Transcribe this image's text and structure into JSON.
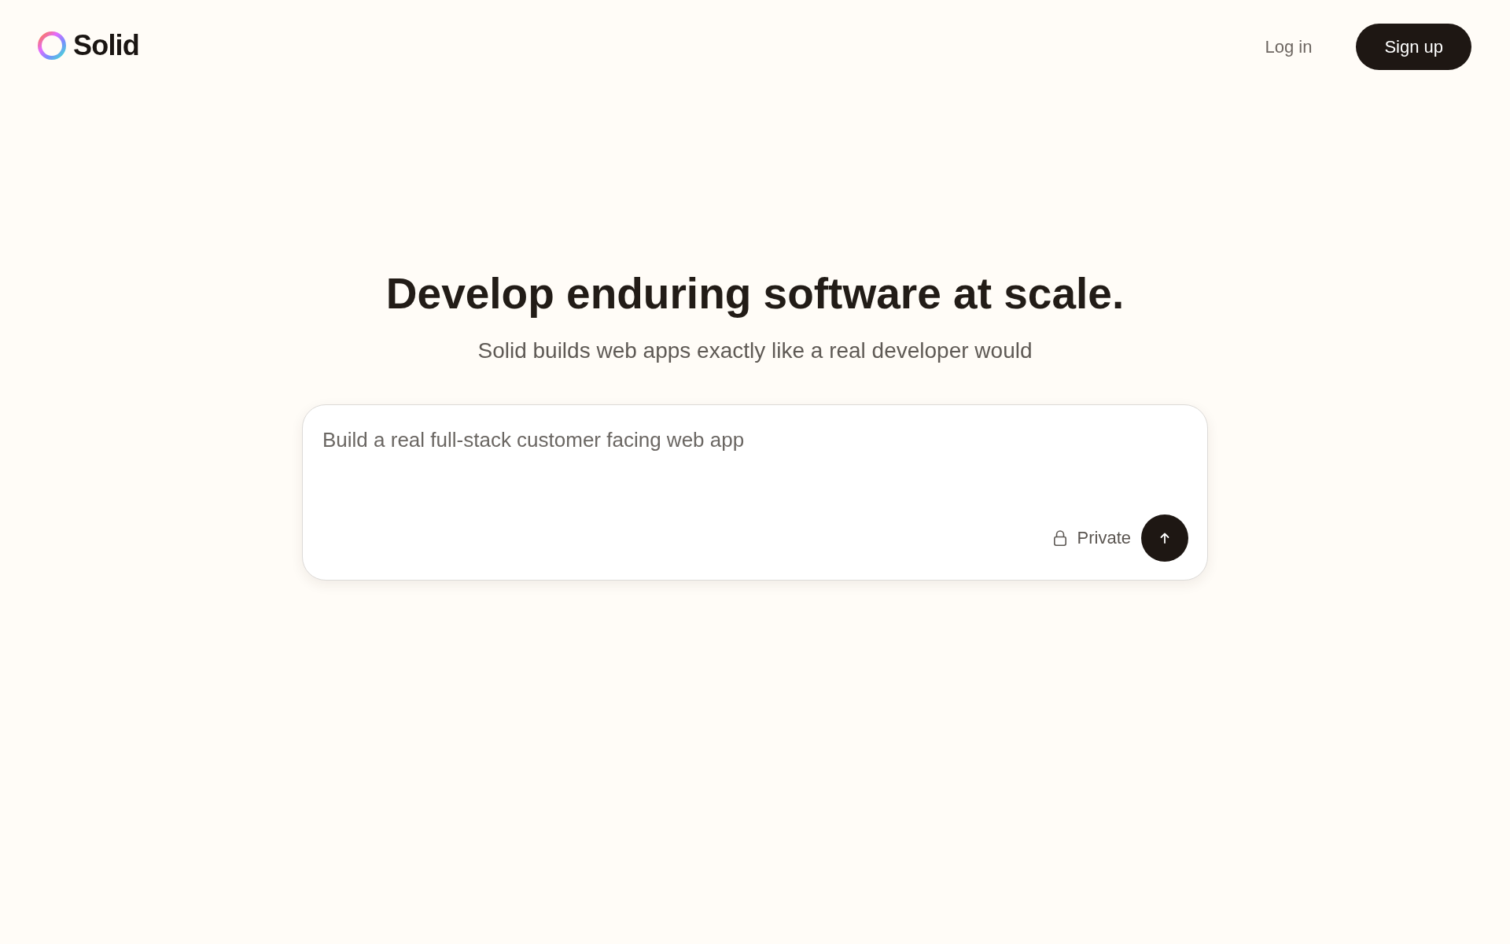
{
  "header": {
    "logo": {
      "name": "Solid"
    },
    "nav": [
      {
        "label": "Log in",
        "kind": "link"
      },
      {
        "label": "Sign up",
        "kind": "button"
      }
    ]
  },
  "hero": {
    "title": "Develop enduring software at scale.",
    "subtitle": "Solid builds web apps exactly like a real developer would"
  },
  "prompt": {
    "placeholder": "Build a real full-stack customer facing web app",
    "visibility": {
      "label": "Private"
    }
  }
}
